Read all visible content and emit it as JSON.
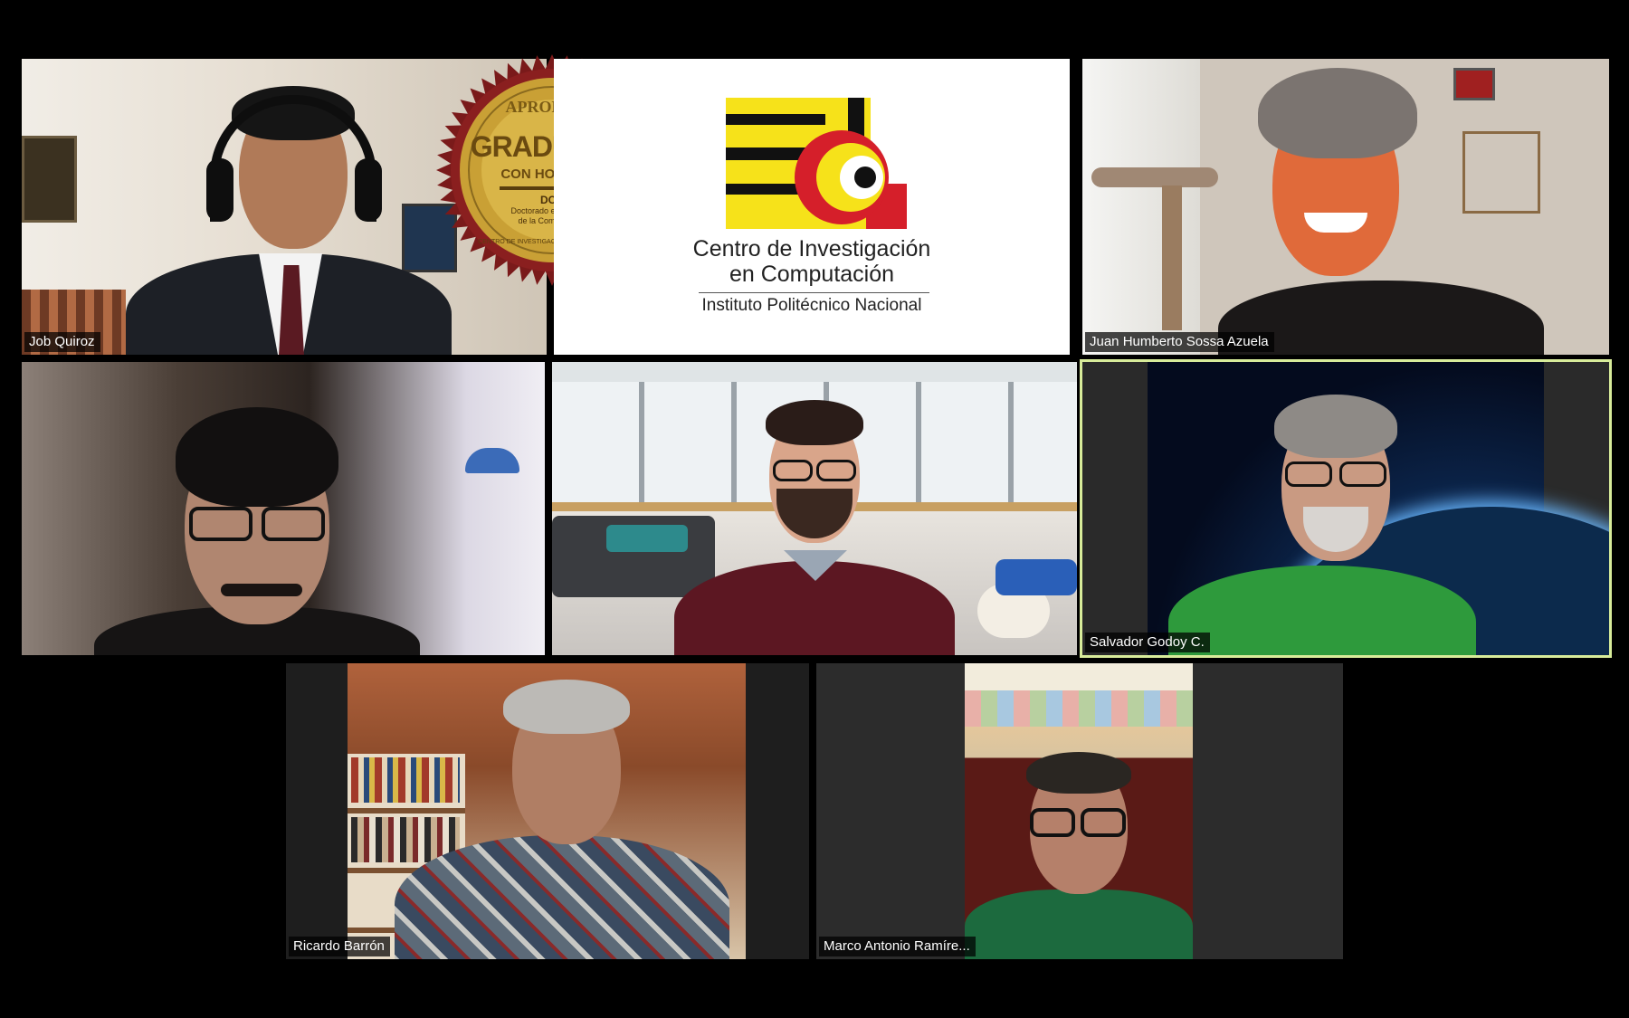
{
  "participants": [
    {
      "name": "Job Quiroz"
    },
    {
      "name": "Juan Humberto Sossa Azuela"
    },
    {
      "name": "Salvador Godoy C."
    },
    {
      "name": "Ricardo Barrón"
    },
    {
      "name": "Marco Antonio Ramíre..."
    }
  ],
  "seal": {
    "top_text": "APROBADO",
    "main_text": "GRADUADO",
    "sub_text": "CON HONORES",
    "program_code": "DCC",
    "program_line1": "Doctorado en Ciencias",
    "program_line2": "de la Computación",
    "ring_text": "CENTRO DE INVESTIGACIÓN EN COMPUTACIÓN"
  },
  "institution": {
    "name_line1": "Centro de Investigación",
    "name_line2": "en Computación",
    "parent": "Instituto Politécnico Nacional"
  },
  "colors": {
    "active_speaker_border": "#d8ec9a",
    "logo_yellow": "#f6e21a",
    "logo_red": "#d51f2a",
    "logo_black": "#111111",
    "seal_gold": "#c9a035",
    "seal_maroon": "#7a1a1a"
  }
}
